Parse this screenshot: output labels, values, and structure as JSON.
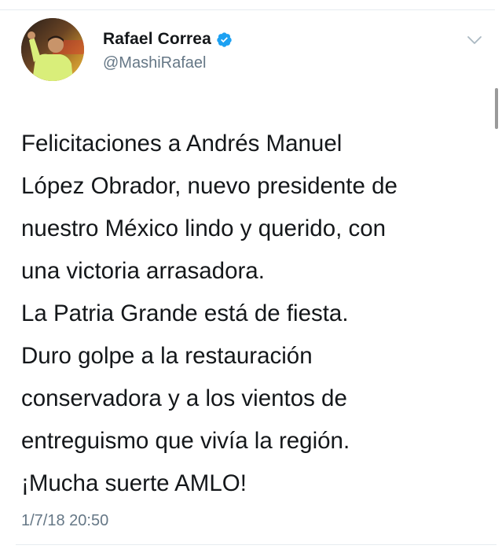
{
  "author": {
    "display_name": "Rafael Correa",
    "handle": "@MashiRafael",
    "verified": true
  },
  "tweet": {
    "lines": [
      "Felicitaciones a Andrés Manuel",
      "López Obrador, nuevo presidente de",
      "nuestro México lindo y querido, con",
      "una victoria arrasadora.",
      "La Patria Grande está de fiesta.",
      "Duro golpe a la restauración",
      "conservadora y a los vientos de",
      "entreguismo que vivía la región.",
      "¡Mucha suerte AMLO!"
    ],
    "timestamp": "1/7/18 20:50"
  },
  "icons": {
    "verified": "verified-badge-icon",
    "menu": "chevron-down-icon"
  },
  "colors": {
    "verified_blue": "#1da1f2",
    "text_primary": "#14171a",
    "text_secondary": "#657786"
  }
}
